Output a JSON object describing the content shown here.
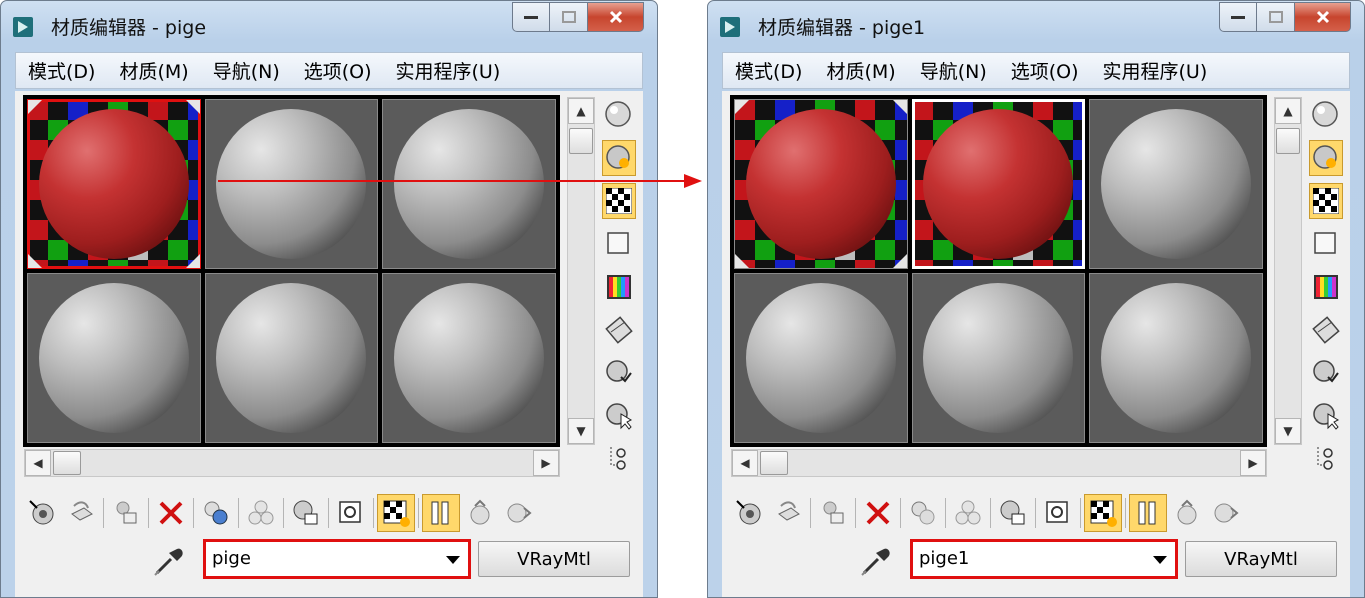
{
  "windows": [
    {
      "title": "材质编辑器 - pige",
      "menu": [
        "模式(D)",
        "材质(M)",
        "导航(N)",
        "选项(O)",
        "实用程序(U)"
      ],
      "material_name": "pige",
      "material_type": "VRayMtl"
    },
    {
      "title": "材质编辑器 - pige1",
      "menu": [
        "模式(D)",
        "材质(M)",
        "导航(N)",
        "选项(O)",
        "实用程序(U)"
      ],
      "material_name": "pige1",
      "material_type": "VRayMtl"
    }
  ],
  "colors": {
    "selection_highlight": "#e01010",
    "active_tool": "#ffd86b",
    "annotation_arrow": "#e01010"
  },
  "icons": {
    "side_tools": [
      "sample-type-sphere-icon",
      "backlight-icon",
      "background-checker-icon",
      "sample-uv-tiling-icon",
      "video-color-check-icon",
      "make-preview-icon",
      "options-icon",
      "select-by-material-icon",
      "material-map-navigator-icon"
    ],
    "bottom_tools": [
      "get-material-icon",
      "put-to-scene-icon",
      "assign-to-selection-icon",
      "reset-map-icon",
      "make-unique-icon",
      "put-to-library-icon",
      "material-id-channel-icon",
      "show-in-viewport-icon",
      "show-end-result-icon",
      "go-to-parent-icon",
      "go-forward-to-sibling-icon",
      "eyedropper-icon"
    ]
  }
}
